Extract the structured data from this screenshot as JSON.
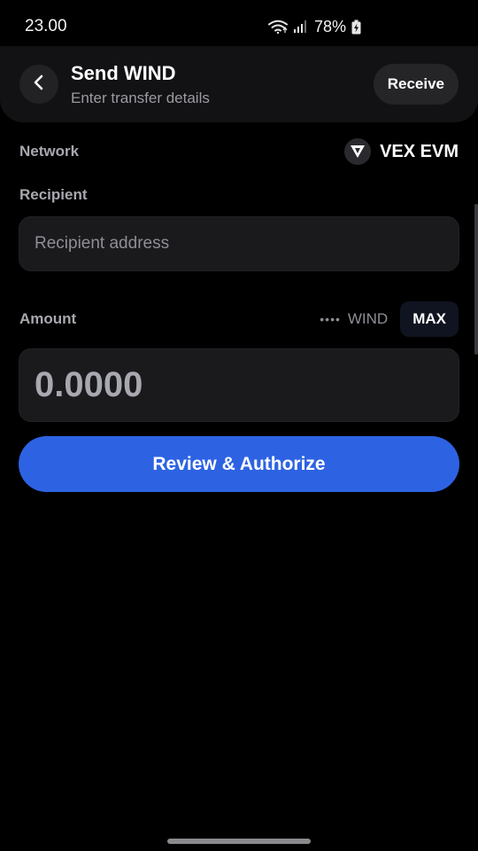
{
  "status_bar": {
    "time": "23.00",
    "battery": "78%",
    "icons": [
      "wifi-icon",
      "signal-icon",
      "battery-charging-icon"
    ]
  },
  "header": {
    "title": "Send WIND",
    "subtitle": "Enter transfer details",
    "back_icon": "chevron-left-icon",
    "receive_label": "Receive"
  },
  "network": {
    "label": "Network",
    "value": "VEX EVM",
    "logo_icon": "vex-logo-icon"
  },
  "recipient": {
    "label": "Recipient",
    "placeholder": "Recipient address",
    "value": ""
  },
  "amount": {
    "label": "Amount",
    "balance_masked": "••••",
    "token": "WIND",
    "max_label": "MAX",
    "placeholder": "0.0000",
    "value": ""
  },
  "actions": {
    "review_label": "Review & Authorize"
  },
  "colors": {
    "background": "#000000",
    "surface": "#1a1a1d",
    "accent": "#2d63e3",
    "muted_text": "#a8a8ae"
  }
}
